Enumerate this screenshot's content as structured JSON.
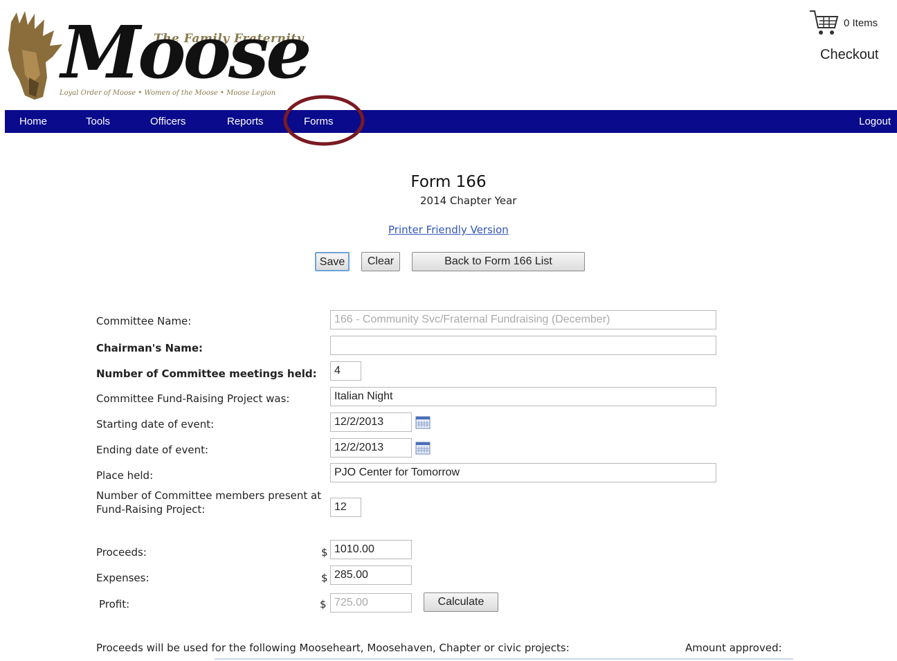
{
  "header": {
    "brand_small": "The Family Fraternity",
    "brand_big": "Moose",
    "brand_tagline": "Loyal Order of Moose • Women of the Moose • Moose Legion"
  },
  "cart": {
    "icon": "cart-icon",
    "count_label": "0 Items",
    "checkout_label": "Checkout"
  },
  "nav": {
    "items": [
      "Home",
      "Tools",
      "Officers",
      "Reports",
      "Forms"
    ],
    "logout": "Logout",
    "color": "#0a0a8c",
    "highlight_circle_color": "#7a1a22"
  },
  "form": {
    "title": "Form 166",
    "subtitle": "2014 Chapter Year",
    "printer_link": "Printer Friendly Version",
    "buttons": {
      "save": "Save",
      "clear": "Clear",
      "back": "Back to Form 166 List",
      "calculate": "Calculate"
    },
    "fields": {
      "committee_name_label": "Committee Name:",
      "committee_name_value": "166 - Community Svc/Fraternal Fundraising (December)",
      "chairman_label": "Chairman's Name:",
      "chairman_value": "",
      "meetings_label": "Number of Committee meetings held:",
      "meetings_value": "4",
      "project_label": "Committee Fund-Raising Project was:",
      "project_value": "Italian Night",
      "start_label": "Starting date of event:",
      "start_value": "12/2/2013",
      "end_label": "Ending date of event:",
      "end_value": "12/2/2013",
      "place_label": "Place held:",
      "place_value": "PJO Center for Tomorrow",
      "members_label_line1": "Number of Committee members present at",
      "members_label_line2": "Fund-Raising Project:",
      "members_value": "12",
      "currency_symbol": "$",
      "proceeds_label": "Proceeds:",
      "proceeds_value": "1010.00",
      "expenses_label": "Expenses:",
      "expenses_value": "285.00",
      "profit_label": "Profit:",
      "profit_value": "725.00"
    },
    "bottom": {
      "proceeds_used_label": "Proceeds will be used for the following Mooseheart, Moosehaven, Chapter or civic projects:",
      "amount_approved_label": "Amount approved:"
    }
  }
}
